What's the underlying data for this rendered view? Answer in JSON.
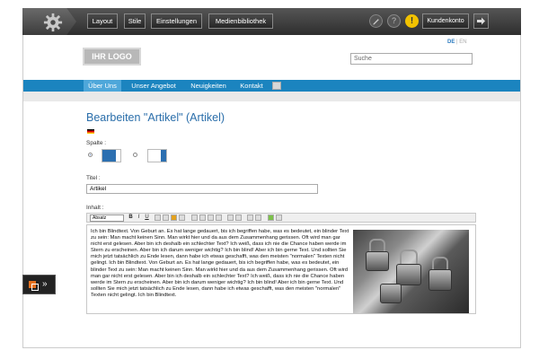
{
  "toolbar": {
    "buttons": [
      "Layout",
      "Stile",
      "Einstellungen",
      "Medienbibliothek"
    ],
    "account_label": "Kundenkonto",
    "help_glyph": "?",
    "warning_glyph": "!"
  },
  "language": {
    "de": "DE",
    "separator": "|",
    "en": "EN"
  },
  "header": {
    "logo_text": "IHR LOGO",
    "search_placeholder": "Suche"
  },
  "nav": {
    "items": [
      "Über Uns",
      "Unser Angebot",
      "Neuigkeiten",
      "Kontakt"
    ]
  },
  "main": {
    "heading": "Bearbeiten \"Artikel\" (Artikel)",
    "column_label": "Spalte :",
    "title_label": "Titel :",
    "title_value": "Artikel",
    "content_label": "Inhalt :"
  },
  "editor": {
    "format_value": "Absatz",
    "bold": "B",
    "italic": "I",
    "underline": "U",
    "body_text": "Ich bin Blindtext. Von Geburt an. Es hat lange gedauert, bis ich begriffen habe, was es bedeutet, ein blinder Text zu sein: Man macht keinen Sinn. Man wirkt hier und da aus dem Zusammenhang gerissen. Oft wird man gar nicht erst gelesen. Aber bin ich deshalb ein schlechter Text? Ich weiß, dass ich nie die Chance haben werde im Stern zu erscheinen. Aber bin ich darum weniger wichtig? Ich bin blind! Aber ich bin gerne Text. Und sollten Sie mich jetzt tatsächlich zu Ende lesen, dann habe ich etwas geschafft, was den meisten \"normalen\" Texten nicht gelingt. Ich bin Blindtext. Von Geburt an. Es hat lange gedauert, bis ich begriffen habe, was es bedeutet, ein blinder Text zu sein: Man macht keinen Sinn. Man wirkt hier und da aus dem Zusammenhang gerissen. Oft wird man gar nicht erst gelesen. Aber bin ich deshalb ein schlechter Text? Ich weiß, dass ich nie die Chance haben werde im Stern zu erscheinen. Aber bin ich darum weniger wichtig? Ich bin blind! Aber ich bin gerne Text. Und sollten Sie mich jetzt tatsächlich zu Ende lesen, dann habe ich etwas geschafft, was den meisten \"normalen\" Texten nicht gelingt. Ich bin Blindtext."
  },
  "side_tab": {
    "glyph": "»"
  },
  "colors": {
    "nav_blue": "#1b84bf",
    "nav_active": "#4ea7da",
    "heading_blue": "#2a6eaa",
    "warning_yellow": "#f2c200"
  },
  "icons": [
    "gear-icon",
    "edit-icon",
    "help-icon",
    "warning-icon",
    "arrow-right-icon",
    "flag-de-icon",
    "layout-switch-icon"
  ]
}
